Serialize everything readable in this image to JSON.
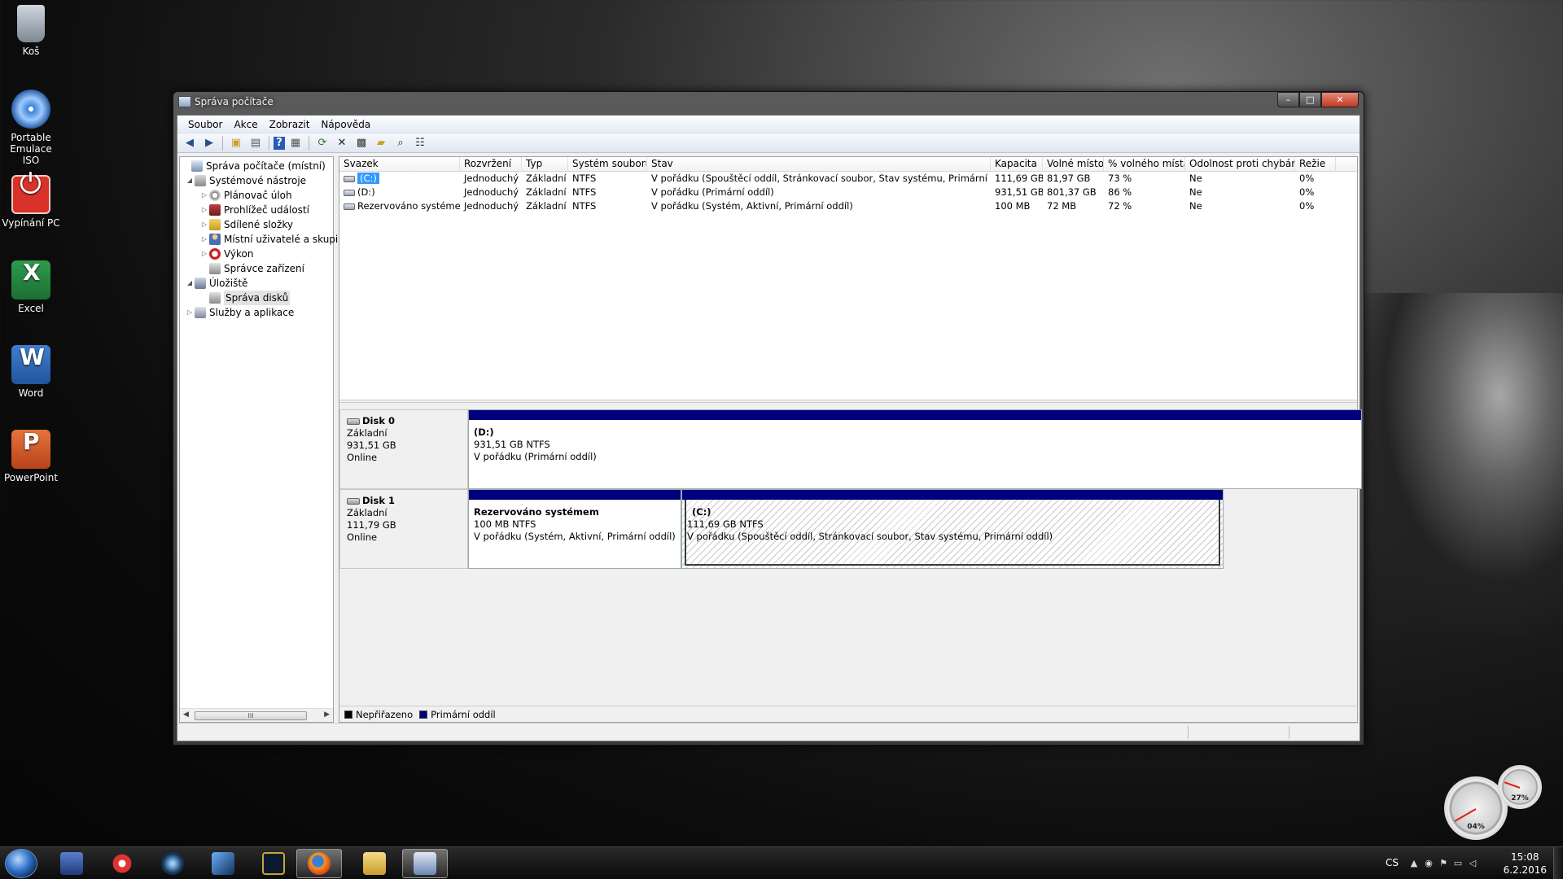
{
  "desktop": {
    "icons": [
      {
        "label": "Koš",
        "icon": "recycle-bin-icon"
      },
      {
        "label": "Portable Emulace ISO",
        "icon": "iso-emulator-icon"
      },
      {
        "label": "Vypínání PC",
        "icon": "power-icon"
      },
      {
        "label": "Excel",
        "icon": "excel-icon"
      },
      {
        "label": "Word",
        "icon": "word-icon"
      },
      {
        "label": "PowerPoint",
        "icon": "powerpoint-icon"
      }
    ]
  },
  "window": {
    "title": "Správa počítače",
    "caption": {
      "minimize": "–",
      "maximize": "□",
      "close": "✕"
    },
    "menu": [
      "Soubor",
      "Akce",
      "Zobrazit",
      "Nápověda"
    ],
    "toolbar": [
      "back-icon",
      "forward-icon",
      "up-icon",
      "show-hide-tree-icon",
      "help-icon",
      "properties-icon",
      "refresh-icon",
      "delete-icon",
      "open-icon",
      "folder-icon",
      "search-icon",
      "settings-icon"
    ]
  },
  "tree": {
    "items": [
      {
        "label": "Správa počítače (místní)",
        "expander": "",
        "level": 0
      },
      {
        "label": "Systémové nástroje",
        "expander": "◢",
        "level": 1
      },
      {
        "label": "Plánovač úloh",
        "expander": "▷",
        "level": 2
      },
      {
        "label": "Prohlížeč událostí",
        "expander": "▷",
        "level": 2
      },
      {
        "label": "Sdílené složky",
        "expander": "▷",
        "level": 2
      },
      {
        "label": "Místní uživatelé a skupiny",
        "expander": "▷",
        "level": 2
      },
      {
        "label": "Výkon",
        "expander": "▷",
        "level": 2
      },
      {
        "label": "Správce zařízení",
        "expander": "",
        "level": 2
      },
      {
        "label": "Úložiště",
        "expander": "◢",
        "level": 1
      },
      {
        "label": "Správa disků",
        "expander": "",
        "level": 2,
        "selected": true
      },
      {
        "label": "Služby a aplikace",
        "expander": "▷",
        "level": 1
      }
    ],
    "scroll_thumb": "III"
  },
  "volumes": {
    "columns": [
      "Svazek",
      "Rozvržení",
      "Typ",
      "Systém souborů",
      "Stav",
      "Kapacita",
      "Volné místo",
      "% volného místa",
      "Odolnost proti chybám",
      "Režie"
    ],
    "rows": [
      [
        "(C:)",
        "Jednoduchý",
        "Základní",
        "NTFS",
        "V pořádku (Spouštěcí oddíl, Stránkovací soubor, Stav systému, Primární oddíl)",
        "111,69 GB",
        "81,97 GB",
        "73 %",
        "Ne",
        "0%"
      ],
      [
        "(D:)",
        "Jednoduchý",
        "Základní",
        "NTFS",
        "V pořádku (Primární oddíl)",
        "931,51 GB",
        "801,37 GB",
        "86 %",
        "Ne",
        "0%"
      ],
      [
        "Rezervováno systémem",
        "Jednoduchý",
        "Základní",
        "NTFS",
        "V pořádku (Systém, Aktivní, Primární oddíl)",
        "100 MB",
        "72 MB",
        "72 %",
        "Ne",
        "0%"
      ]
    ]
  },
  "disks": [
    {
      "name": "Disk 0",
      "type": "Základní",
      "size": "931,51 GB",
      "status": "Online",
      "partitions": [
        {
          "name": "(D:)",
          "size": "931,51 GB NTFS",
          "status": "V pořádku (Primární oddíl)"
        }
      ]
    },
    {
      "name": "Disk 1",
      "type": "Základní",
      "size": "111,79 GB",
      "status": "Online",
      "partitions": [
        {
          "name": "Rezervováno systémem",
          "size": "100 MB NTFS",
          "status": "V pořádku (Systém, Aktivní, Primární oddíl)"
        },
        {
          "name": "(C:)",
          "size": "111,69 GB NTFS",
          "status": "V pořádku (Spouštěcí oddíl, Stránkovací soubor, Stav systému, Primární oddíl)"
        }
      ]
    }
  ],
  "legend": [
    {
      "label": "Nepřiřazeno",
      "color": "#000000"
    },
    {
      "label": "Primární oddíl",
      "color": "#00007f"
    }
  ],
  "gadget": {
    "cpu": "04%",
    "memory": "27%"
  },
  "taskbar": {
    "apps": [
      "explorer-save-icon",
      "ccleaner-icon",
      "media-icon",
      "steam-icon",
      "lol-icon",
      "firefox-icon",
      "folder-icon",
      "computer-management-icon"
    ],
    "tray": {
      "lang": "CS",
      "time": "15:08",
      "date": "6.2.2016"
    }
  }
}
